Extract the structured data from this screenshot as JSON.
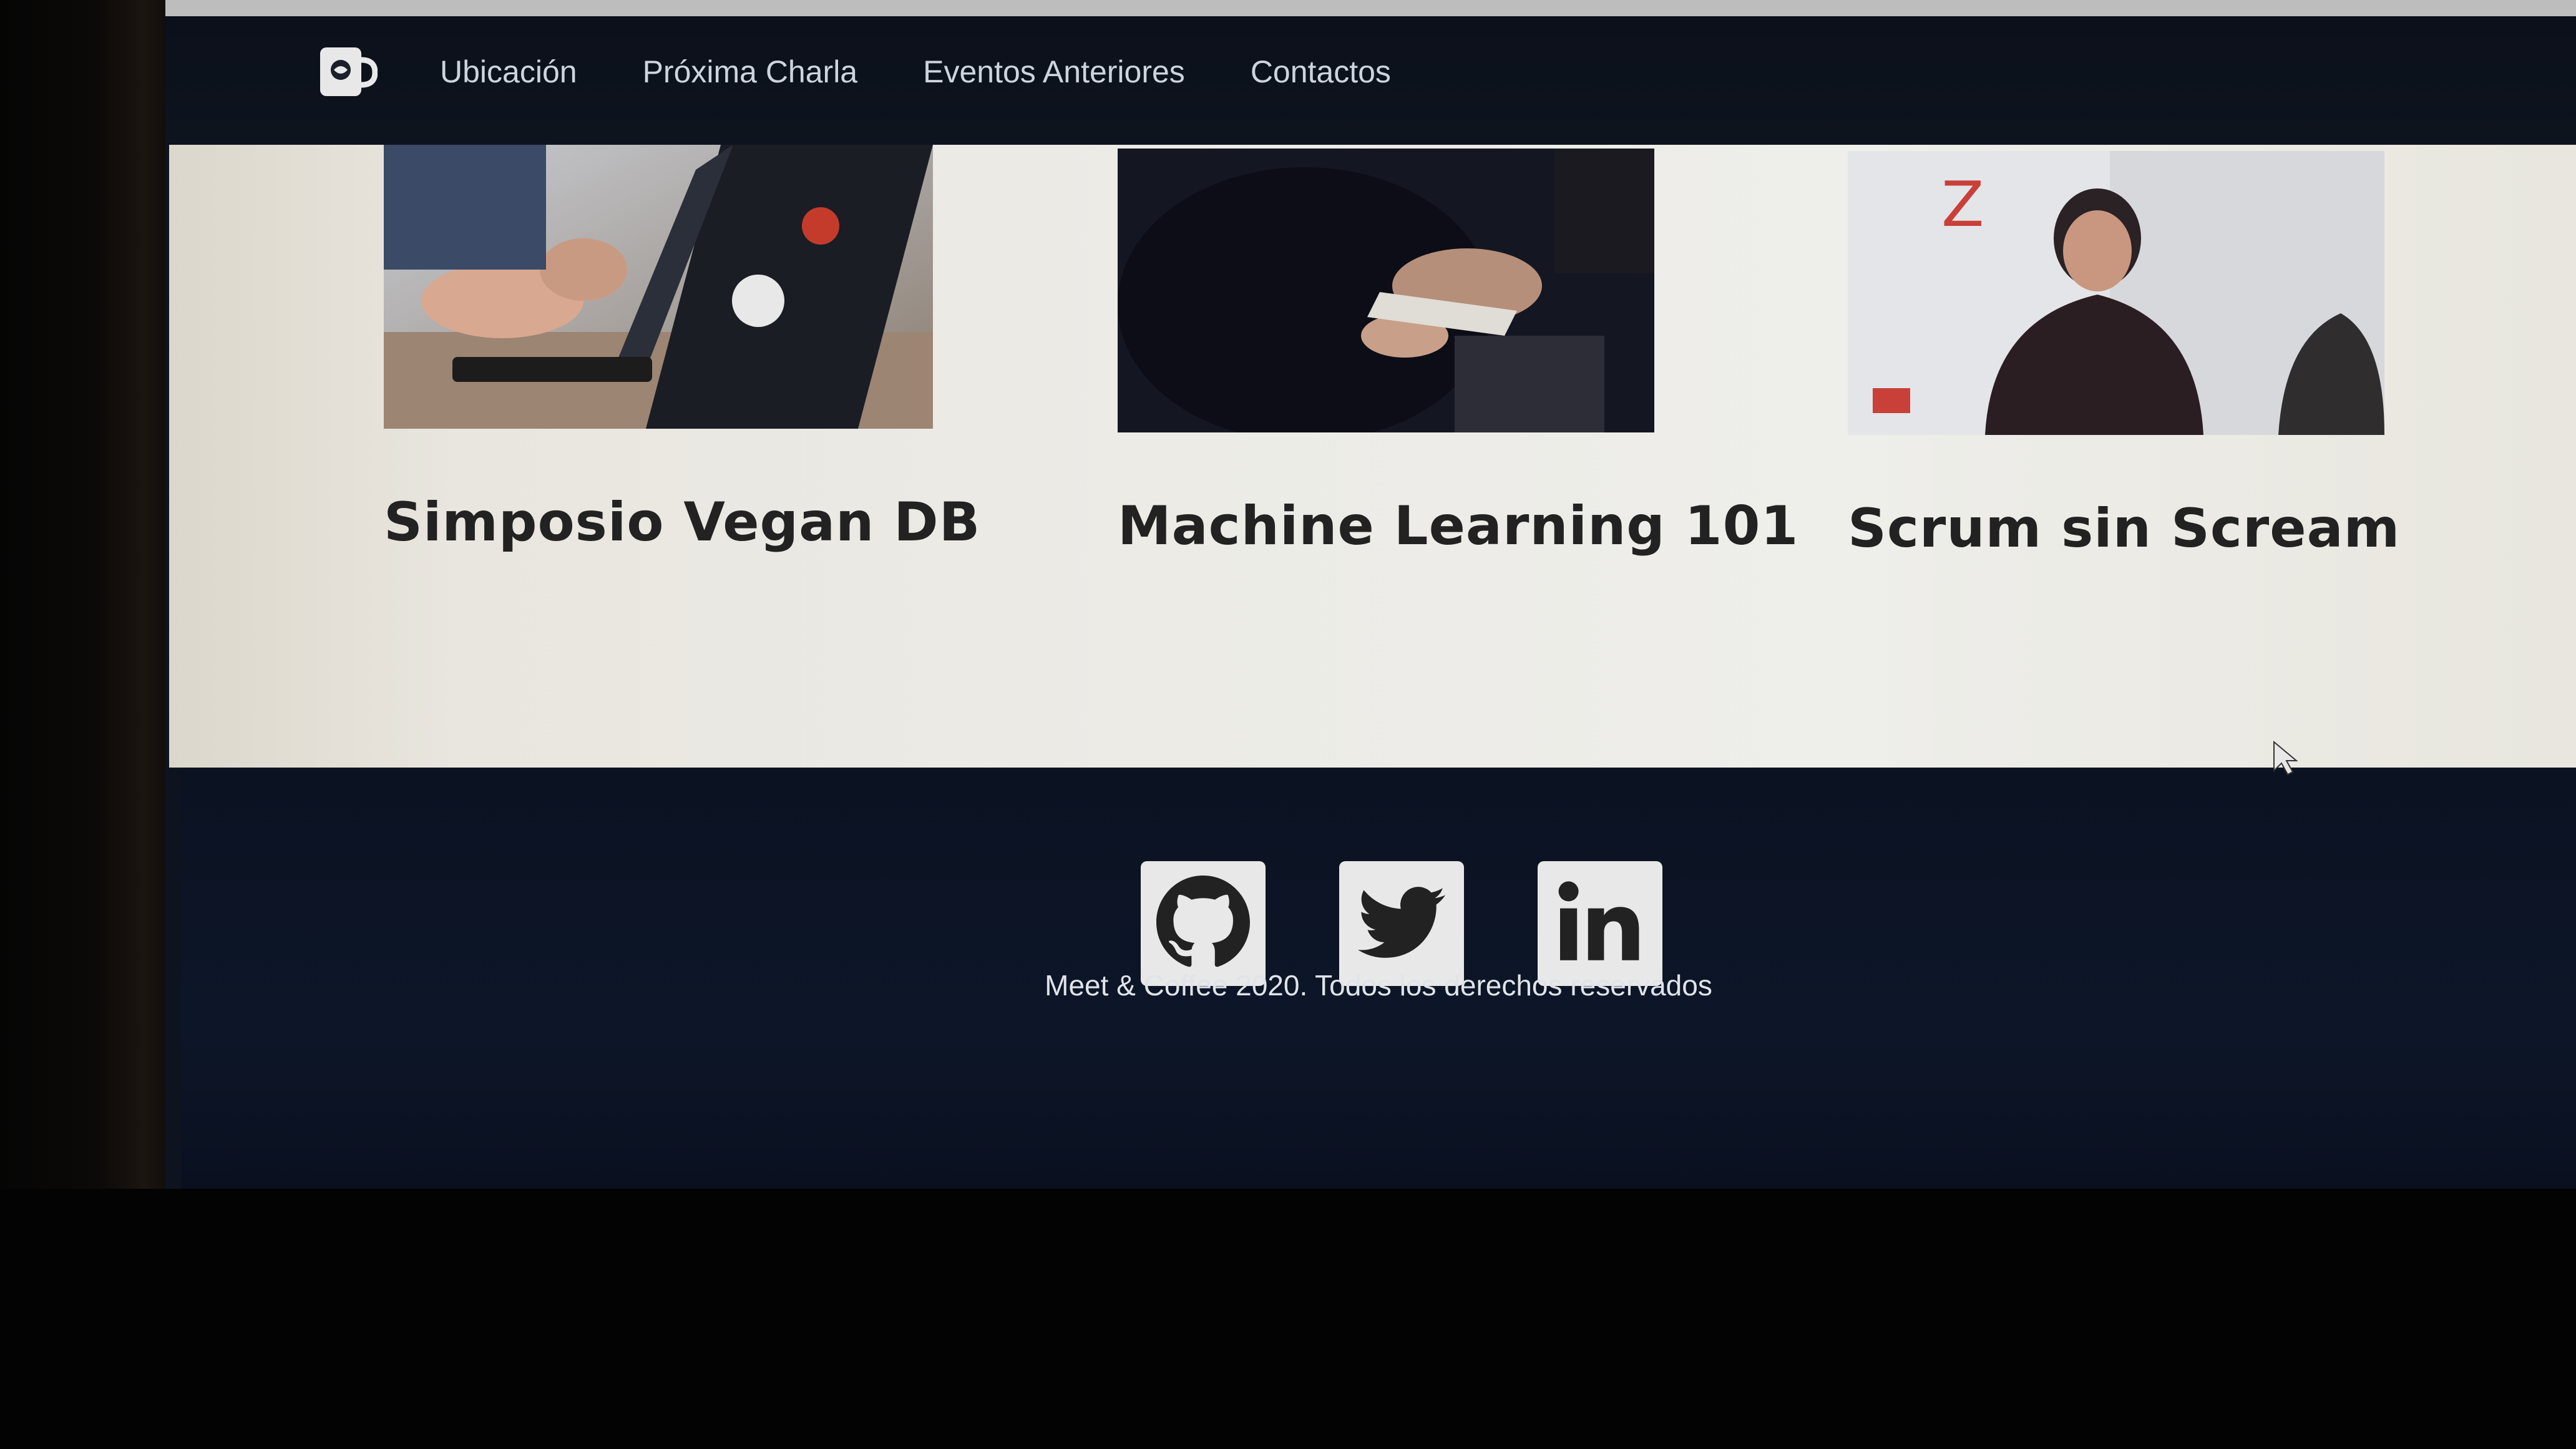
{
  "nav": {
    "links": [
      "Ubicación",
      "Próxima Charla",
      "Eventos Anteriores",
      "Contactos"
    ]
  },
  "cards": [
    {
      "title": "Simposio Vegan DB"
    },
    {
      "title": "Machine Learning 101"
    },
    {
      "title": "Scrum sin Scream"
    }
  ],
  "footer": {
    "social": [
      "github-icon",
      "twitter-icon",
      "linkedin-icon"
    ],
    "copyright": "Meet & Coffee 2020. Todos los derechos reservados"
  },
  "colors": {
    "navbar": "#0e141f",
    "content_bg": "#ecebe6",
    "footer_bg": "#0d1628",
    "title_text": "#222222",
    "social_bg": "#e8e8e8"
  }
}
